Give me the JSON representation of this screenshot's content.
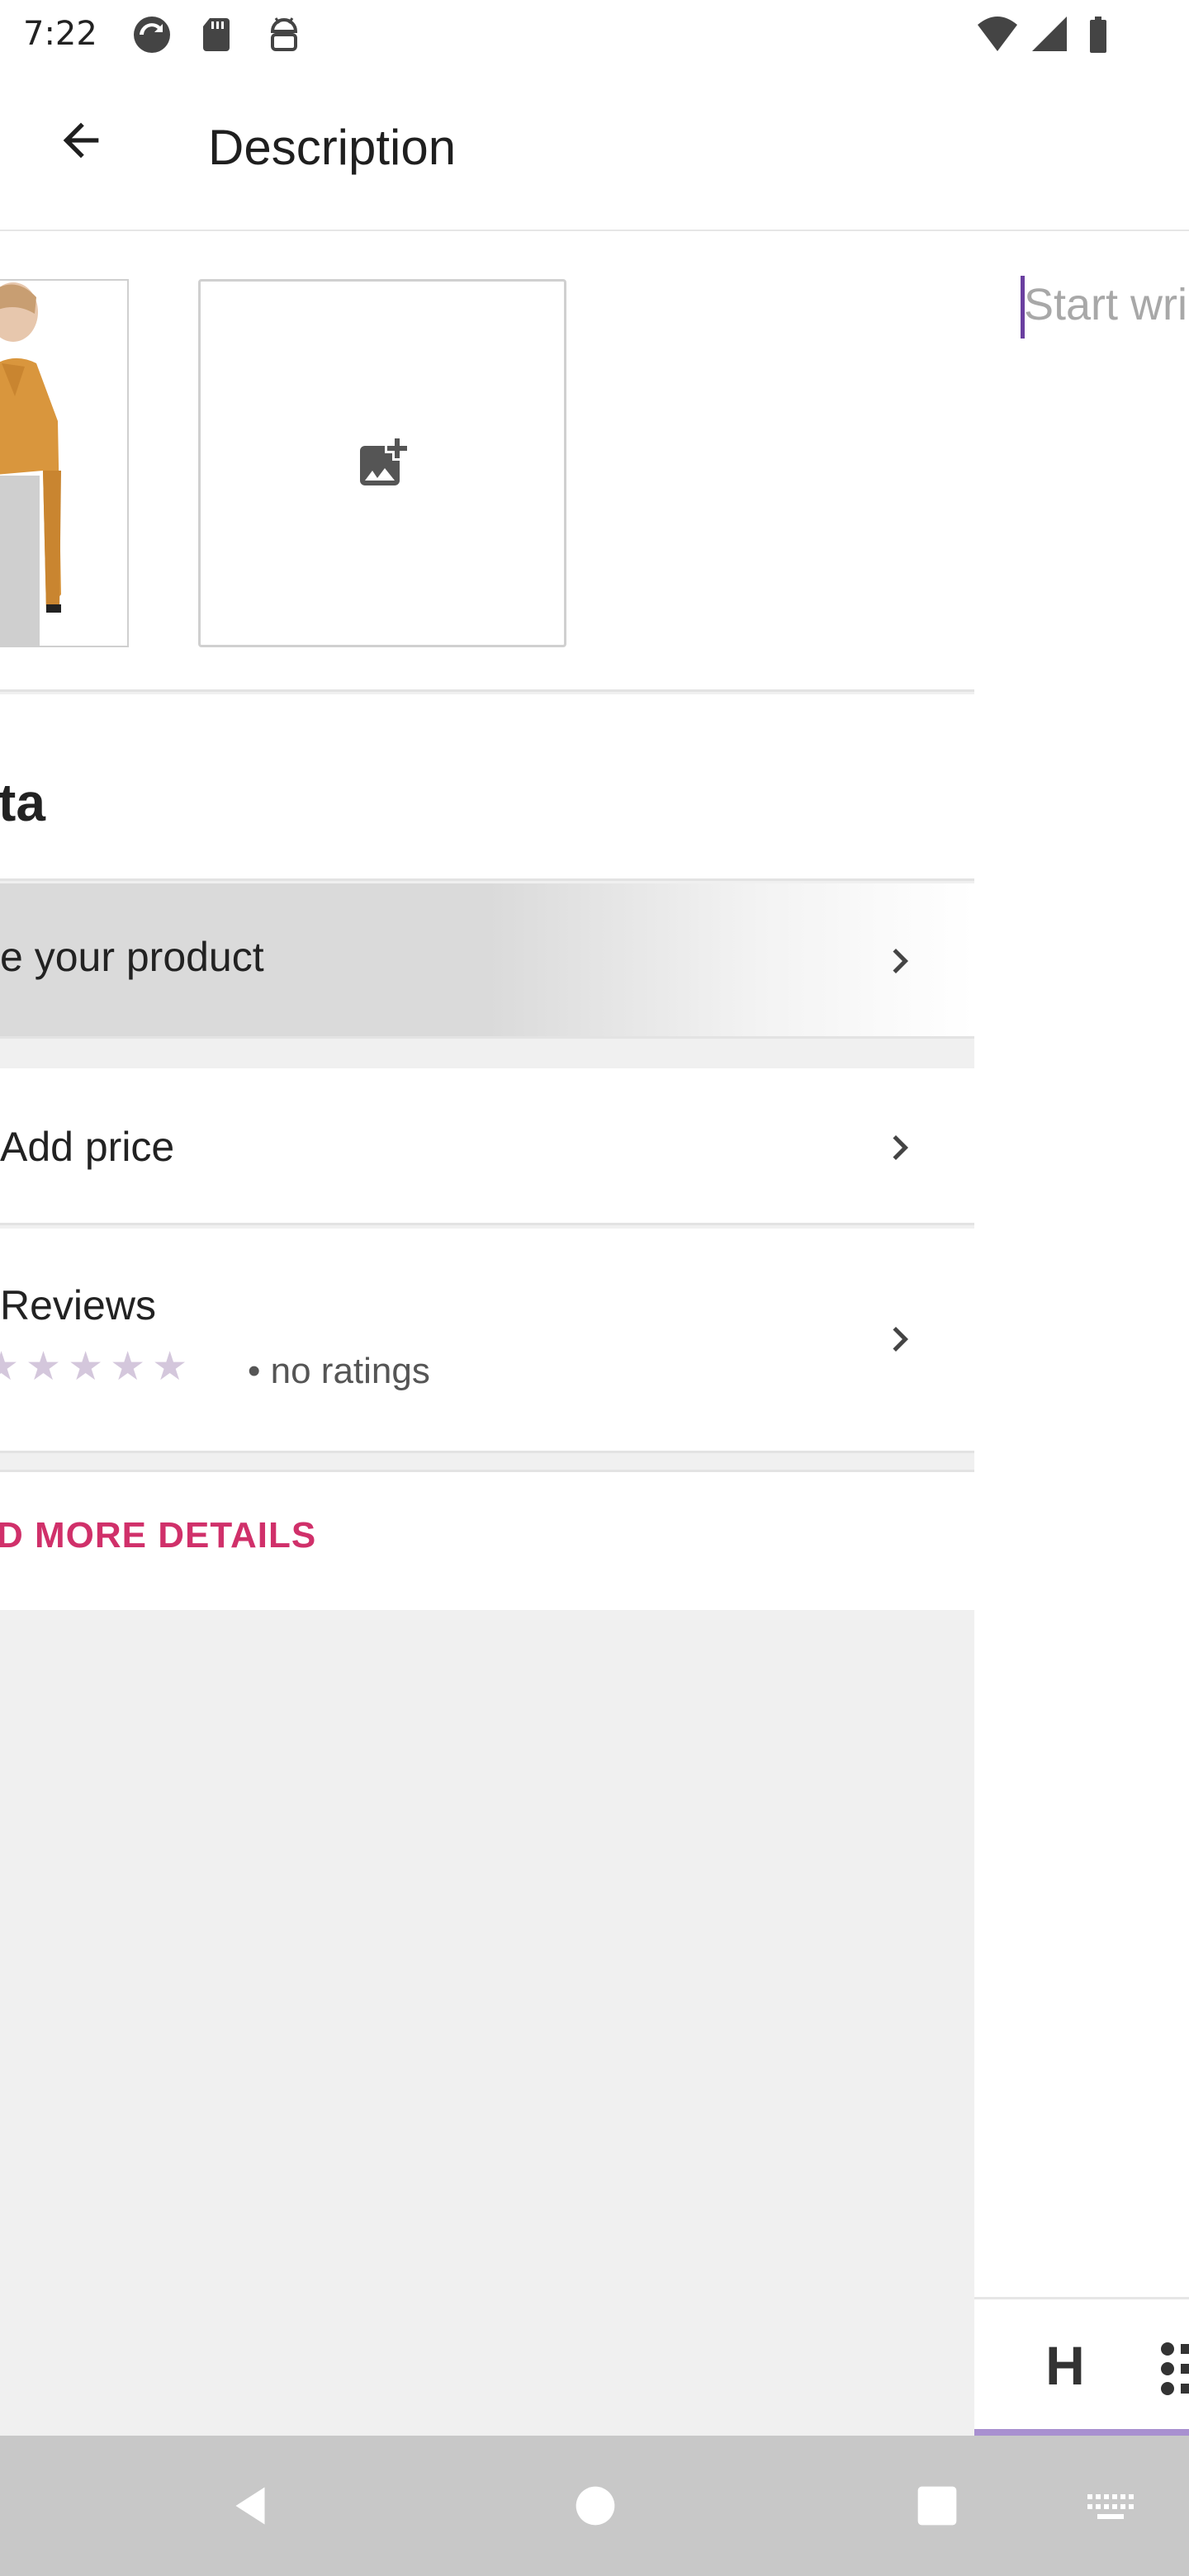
{
  "status_bar": {
    "time": "7:22",
    "left_icons": [
      "sync-icon",
      "sd-card-icon",
      "android-debug-icon"
    ],
    "right_icons": [
      "wifi-icon",
      "cellular-signal-icon",
      "battery-icon"
    ]
  },
  "app_bar": {
    "title": "Description",
    "back_icon": "arrow-back-icon"
  },
  "product_panel": {
    "add_image_icon": "add-photo-icon",
    "section_title": "ta",
    "describe_label": "e your product",
    "price_label": "Add price",
    "reviews": {
      "label": "Reviews",
      "stars": [
        "★",
        "★",
        "★",
        "★",
        "★"
      ],
      "rating_text": "• no ratings"
    },
    "more_details": "D MORE DETAILS"
  },
  "editor": {
    "placeholder": "Start wri"
  },
  "format_toolbar": {
    "heading_label": "H",
    "list_icon": "bulleted-list-icon"
  },
  "nav_bar": {
    "icons": [
      "back-triangle-icon",
      "home-circle-icon",
      "recents-square-icon",
      "keyboard-icon"
    ]
  },
  "colors": {
    "accent": "#d0306a",
    "cursor": "#6a3fa0",
    "toolbar_underline": "#a890d0",
    "star_empty": "#d4c7dc"
  }
}
